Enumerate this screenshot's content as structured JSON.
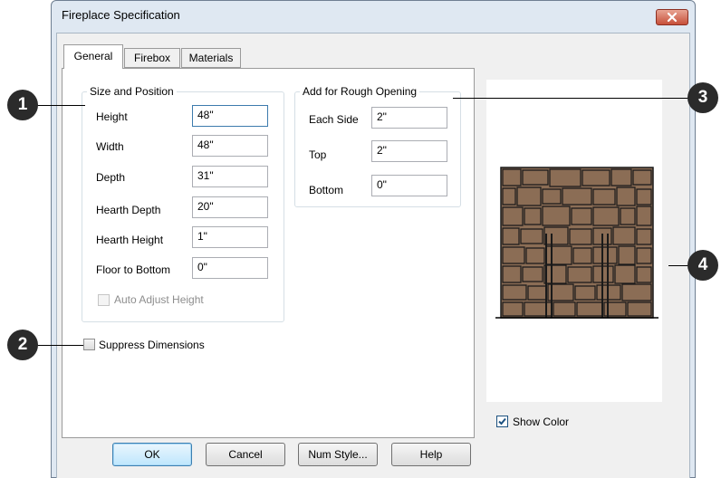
{
  "window": {
    "title": "Fireplace Specification",
    "close_icon": "close-icon"
  },
  "tabs": [
    {
      "label": "General",
      "active": true
    },
    {
      "label": "Firebox",
      "active": false
    },
    {
      "label": "Materials",
      "active": false
    }
  ],
  "size_position": {
    "legend": "Size and Position",
    "fields": [
      {
        "label": "Height",
        "value": "48\""
      },
      {
        "label": "Width",
        "value": "48\""
      },
      {
        "label": "Depth",
        "value": "31\""
      },
      {
        "label": "Hearth Depth",
        "value": "20\""
      },
      {
        "label": "Hearth Height",
        "value": "1\""
      },
      {
        "label": "Floor to Bottom",
        "value": "0\""
      }
    ],
    "auto_adjust": {
      "label": "Auto Adjust Height",
      "checked": false,
      "enabled": false
    }
  },
  "rough_opening": {
    "legend": "Add for Rough Opening",
    "fields": [
      {
        "label": "Each Side",
        "value": "2\""
      },
      {
        "label": "Top",
        "value": "2\""
      },
      {
        "label": "Bottom",
        "value": "0\""
      }
    ]
  },
  "suppress_dimensions": {
    "label": "Suppress Dimensions",
    "checked": false
  },
  "show_color": {
    "label": "Show Color",
    "checked": true
  },
  "buttons": {
    "ok": "OK",
    "cancel": "Cancel",
    "num_style": "Num Style...",
    "help": "Help"
  },
  "callouts": [
    "1",
    "2",
    "3",
    "4"
  ],
  "colors": {
    "stone_fill": "#8b6d55",
    "stone_line": "#1a1a1a",
    "accent": "#3c7fb1"
  }
}
